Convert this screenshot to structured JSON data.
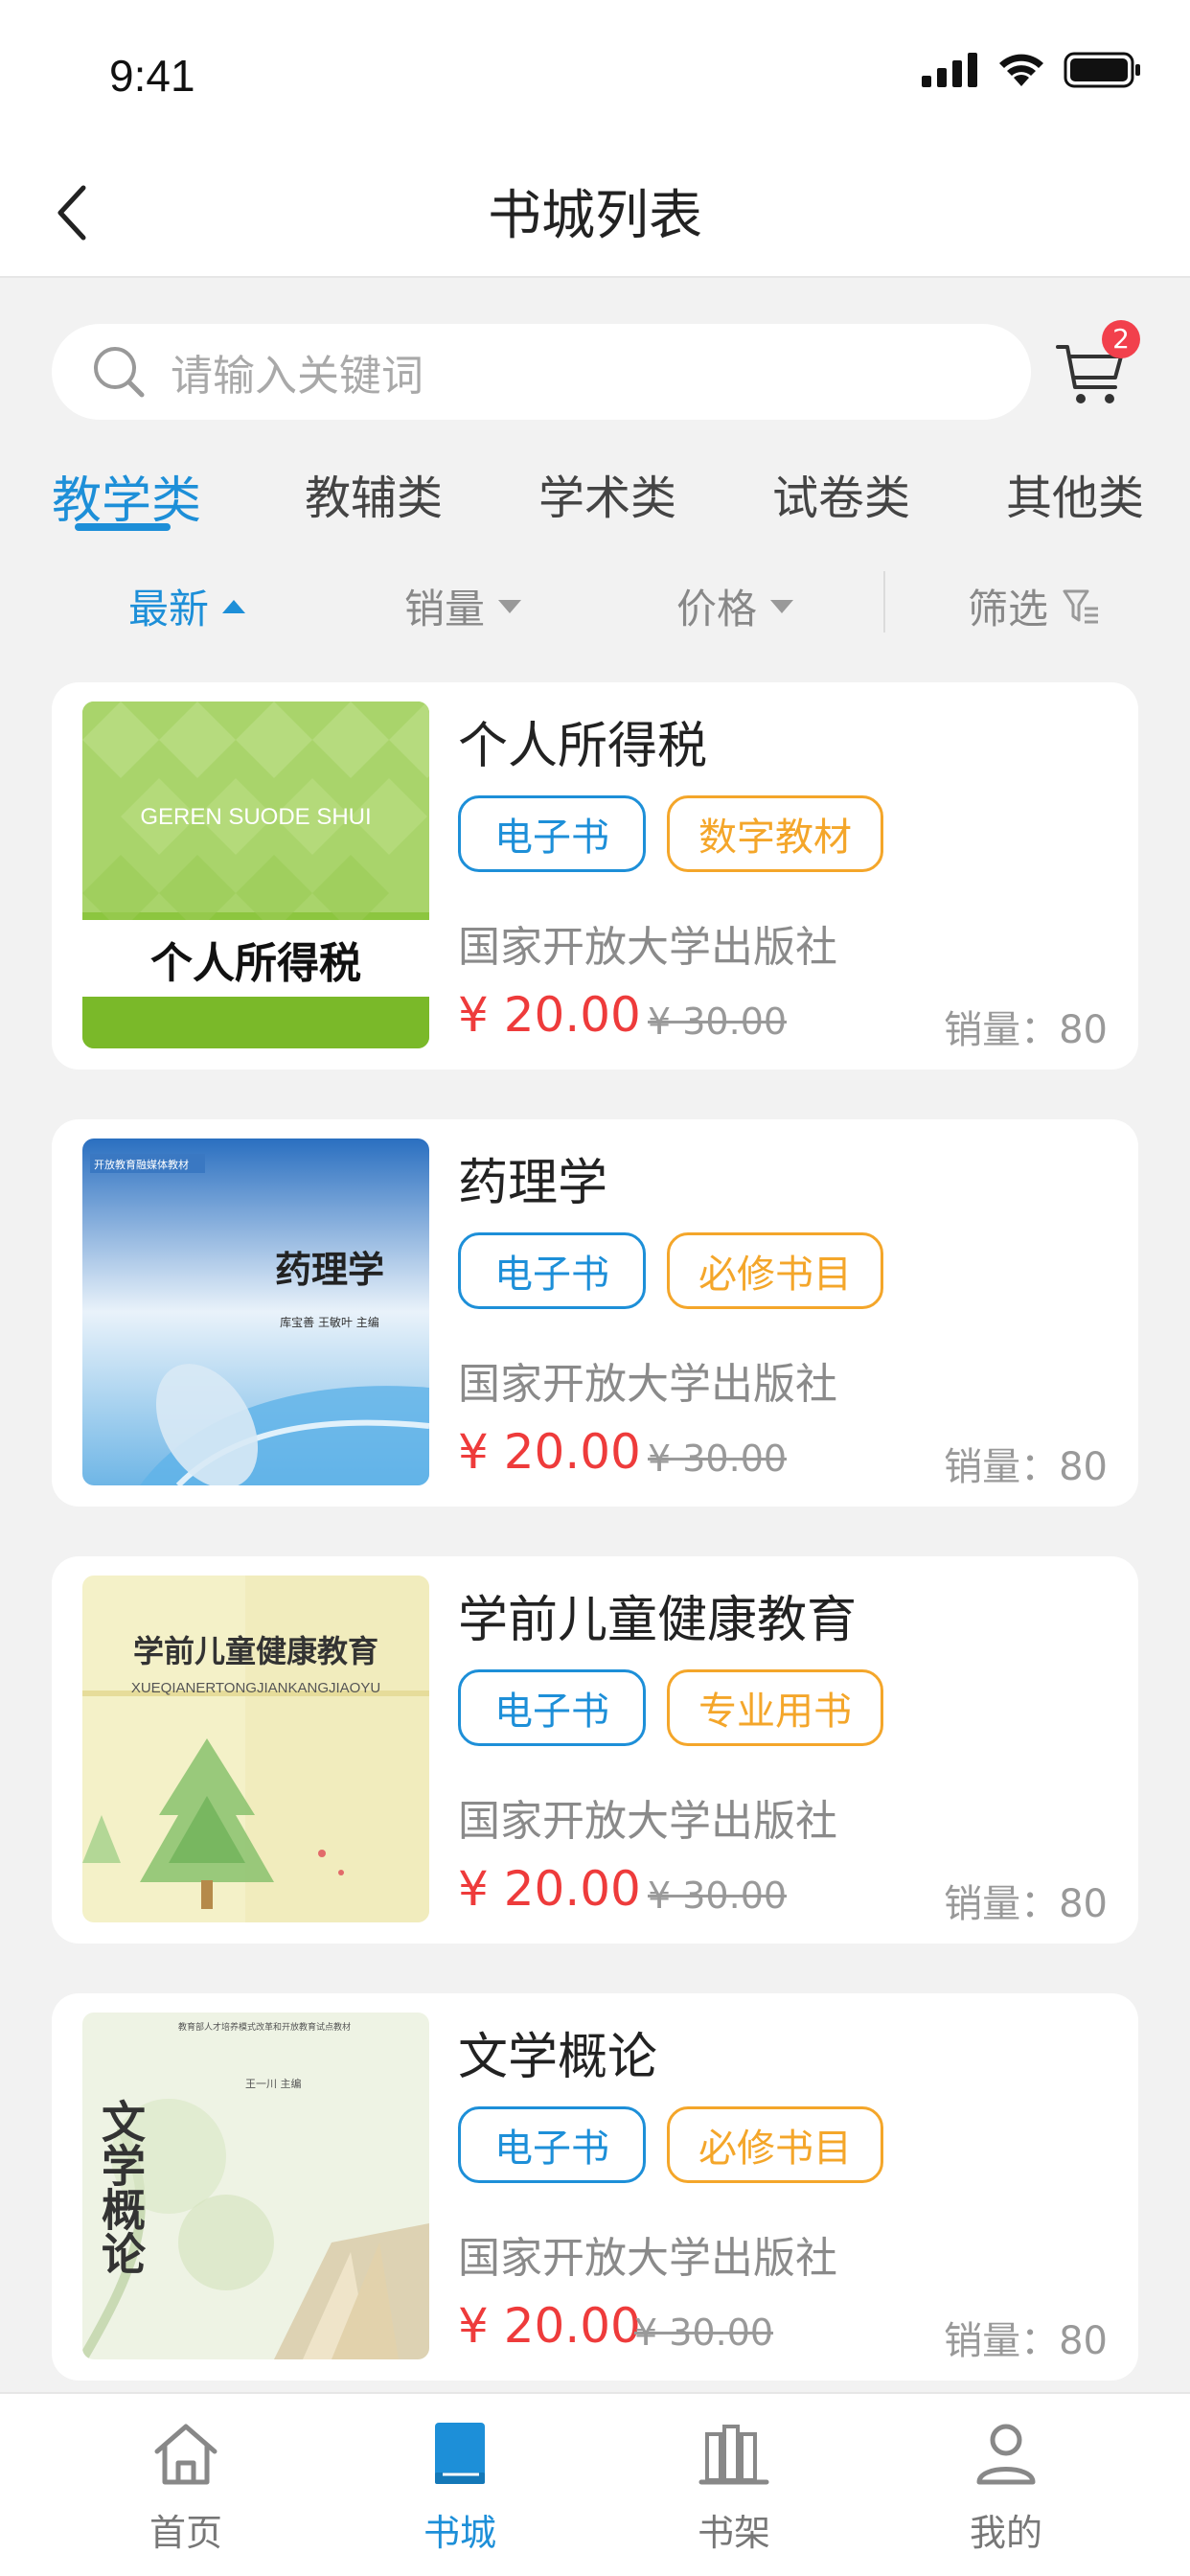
{
  "status_bar": {
    "time": "9:41"
  },
  "header": {
    "title": "书城列表"
  },
  "search": {
    "placeholder": "请输入关键词",
    "cart_count": "2"
  },
  "category_tabs": [
    {
      "label": "教学类",
      "active": true
    },
    {
      "label": "教辅类",
      "active": false
    },
    {
      "label": "学术类",
      "active": false
    },
    {
      "label": "试卷类",
      "active": false
    },
    {
      "label": "其他类",
      "active": false
    }
  ],
  "sort_bar": {
    "latest": "最新",
    "sales": "销量",
    "price": "价格",
    "filter": "筛选"
  },
  "books": [
    {
      "title": "个人所得税",
      "tags": [
        "电子书",
        "数字教材"
      ],
      "publisher": "国家开放大学出版社",
      "price": "¥ 20.00",
      "old_price": "¥ 30.00",
      "sales": "销量：80",
      "cover_title": "个人所得税",
      "cover_subtitle": "GEREN SUODE SHUI"
    },
    {
      "title": "药理学",
      "tags": [
        "电子书",
        "必修书目"
      ],
      "publisher": "国家开放大学出版社",
      "price": "¥ 20.00",
      "old_price": "¥ 30.00",
      "sales": "销量：80",
      "cover_title": "药理学",
      "cover_series": "开放教育融媒体教材",
      "cover_authors": "库宝善 王敏叶 主编"
    },
    {
      "title": "学前儿童健康教育",
      "tags": [
        "电子书",
        "专业用书"
      ],
      "publisher": "国家开放大学出版社",
      "price": "¥ 20.00",
      "old_price": "¥ 30.00",
      "sales": "销量：80",
      "cover_title": "学前儿童健康教育",
      "cover_subtitle": "XUEQIANERTONGJIANKANGJIAOYU"
    },
    {
      "title": "文学概论",
      "tags": [
        "电子书",
        "必修书目"
      ],
      "publisher": "国家开放大学出版社",
      "price": "¥ 20.00",
      "old_price": "¥ 30.00",
      "sales": "销量：80",
      "cover_title": "文学概论",
      "cover_series": "教育部人才培养模式改革和开放教育试点教材",
      "cover_authors": "王一川 主编"
    }
  ],
  "tab_bar": [
    {
      "label": "首页",
      "icon": "home-icon",
      "active": false
    },
    {
      "label": "书城",
      "icon": "book-icon",
      "active": true
    },
    {
      "label": "书架",
      "icon": "bookshelf-icon",
      "active": false
    },
    {
      "label": "我的",
      "icon": "profile-icon",
      "active": false
    }
  ],
  "colors": {
    "accent": "#1d8fd8",
    "price": "#ee3b3b",
    "tag_orange": "#f4a62a",
    "badge": "#f2404c"
  }
}
